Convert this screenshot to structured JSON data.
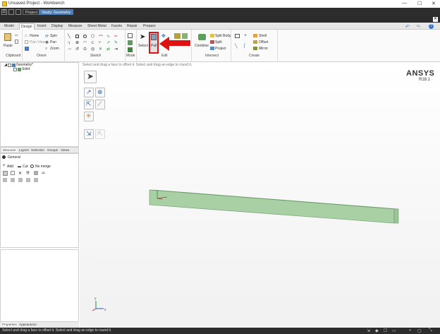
{
  "window": {
    "title": "Unsaved Project - Workbench",
    "minimize": "—",
    "maximize": "☐",
    "close": "✕"
  },
  "app_tabs": {
    "project": "Project",
    "geometry": "Study: Geometry"
  },
  "ribbon_tabs": [
    "Model",
    "Design",
    "Insert",
    "Display",
    "Measure",
    "Sheet Metal",
    "Facets",
    "Repair",
    "Prepare"
  ],
  "active_tab": "Design",
  "clipboard": {
    "paste": "Paste",
    "label": "Clipboard"
  },
  "orient": {
    "home": "Home",
    "spin": "Spin",
    "plan_view": "Plan View",
    "pan": "Pan",
    "zoom": "Zoom",
    "label": "Orient"
  },
  "sketch": {
    "label": "Sketch"
  },
  "mode": {
    "label": "Mode"
  },
  "edit": {
    "select": "Select",
    "pull": "Pull",
    "label": "Edit"
  },
  "intersect": {
    "combine": "Combine",
    "split_body": "Split Body",
    "split": "Split",
    "project": "Project",
    "label": "Intersect"
  },
  "create": {
    "shell": "Shell",
    "offset": "Offset",
    "mirror": "Mirror",
    "label": "Create"
  },
  "tree": {
    "root": "Geometry*",
    "child": "Solid"
  },
  "pane_tabs": [
    "Structure",
    "Layers",
    "Selection",
    "Groups",
    "Views"
  ],
  "general": {
    "title": "General",
    "add": "Add",
    "cut": "Cut",
    "no_merge": "No merge"
  },
  "prop_tabs": [
    "Properties",
    "Appearance"
  ],
  "viewport": {
    "hint": "Select and drag a face to offset it. Select and drag an edge to round it.",
    "brand": "ANSYS",
    "release": "R18.1",
    "axis_x": "x",
    "axis_y": "y",
    "axis_z": "z"
  },
  "status_text": "Select and drag a face to offset it. Select and drag an edge to round it."
}
